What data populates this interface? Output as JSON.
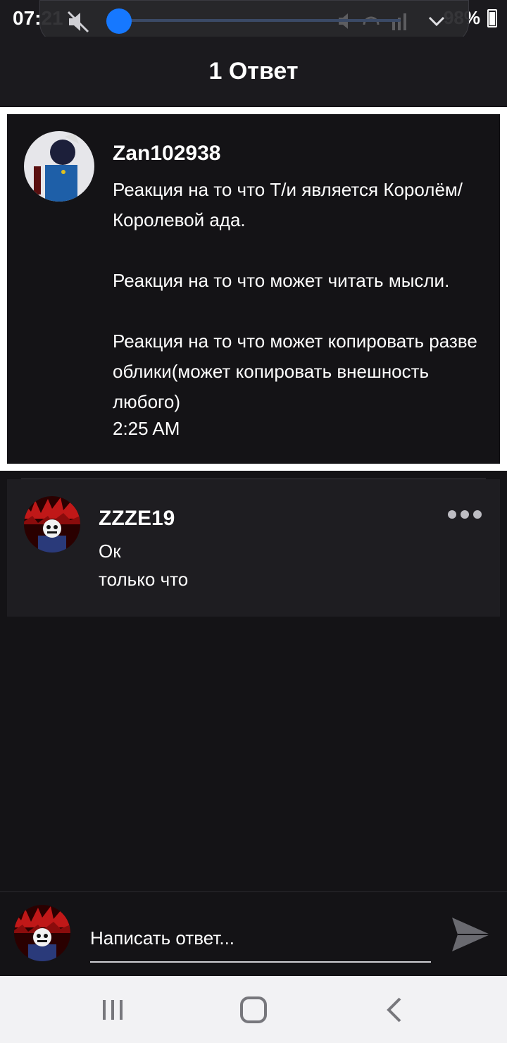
{
  "status_bar": {
    "time": "07:21",
    "battery": "98%"
  },
  "header": {
    "title": "1 Ответ"
  },
  "original_comment": {
    "author": "Zan102938",
    "text": "Реакция на то что Т/и является Королём/Королевой ада.\n\nРеакция на то что может читать мысли.\n\nРеакция на то что может копировать разве облики(может копировать внешность любого)",
    "time": "2:25 AM"
  },
  "reply": {
    "author": "ZZZE19",
    "text": "Ок",
    "time": "только что"
  },
  "composer": {
    "placeholder": "Написать ответ..."
  },
  "icons": {
    "volume": "mute-icon",
    "more": "more-dots-icon",
    "send": "send-icon",
    "nav_recents": "recents-icon",
    "nav_home": "home-icon",
    "nav_back": "back-icon"
  },
  "colors": {
    "background": "#141316",
    "card": "#1e1d21",
    "accent_volume": "#1678ff"
  }
}
